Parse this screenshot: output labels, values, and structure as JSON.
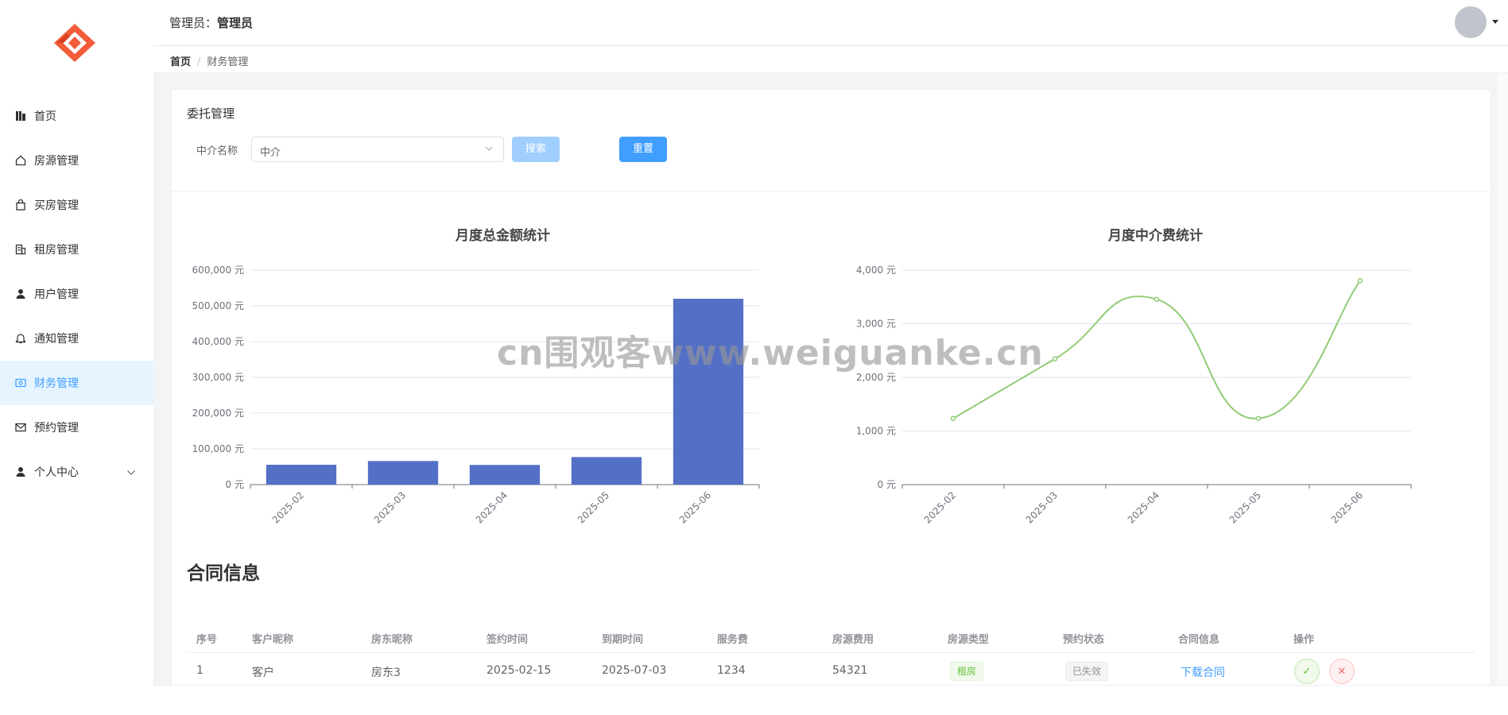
{
  "sidebar": {
    "items": [
      {
        "label": "首页",
        "icon": "dashboard-icon"
      },
      {
        "label": "房源管理",
        "icon": "home-icon"
      },
      {
        "label": "买房管理",
        "icon": "shopping-bag-icon"
      },
      {
        "label": "租房管理",
        "icon": "building-icon"
      },
      {
        "label": "用户管理",
        "icon": "user-icon"
      },
      {
        "label": "通知管理",
        "icon": "bell-icon"
      },
      {
        "label": "财务管理",
        "icon": "wallet-icon",
        "active": true
      },
      {
        "label": "预约管理",
        "icon": "mail-icon"
      },
      {
        "label": "个人中心",
        "icon": "user-icon",
        "expandable": true
      }
    ]
  },
  "header": {
    "role_label": "管理员：",
    "role_name": "管理员"
  },
  "breadcrumb": {
    "home": "首页",
    "separator": "/",
    "current": "财务管理"
  },
  "card": {
    "title": "委托管理",
    "filter": {
      "label": "中介名称",
      "value": "中介"
    },
    "search_label": "搜索",
    "reset_label": "重置"
  },
  "chart_data": [
    {
      "type": "bar",
      "title": "月度总金额统计",
      "categories": [
        "2025-02",
        "2025-03",
        "2025-04",
        "2025-05",
        "2025-06"
      ],
      "values": [
        55555,
        66000,
        55000,
        77000,
        520000
      ],
      "ylim": [
        0,
        600000
      ],
      "yticks": [
        "0 元",
        "100,000 元",
        "200,000 元",
        "300,000 元",
        "400,000 元",
        "500,000 元",
        "600,000 元"
      ],
      "color": "#5470c6",
      "grid": true
    },
    {
      "type": "line",
      "title": "月度中介费统计",
      "categories": [
        "2025-02",
        "2025-03",
        "2025-04",
        "2025-05",
        "2025-06"
      ],
      "values": [
        1234,
        2345,
        3456,
        1234,
        3800
      ],
      "ylim": [
        0,
        4000
      ],
      "yticks": [
        "0 元",
        "1,000 元",
        "2,000 元",
        "3,000 元",
        "4,000 元"
      ],
      "color": "#91cc75",
      "smooth": true,
      "grid": true
    }
  ],
  "contracts": {
    "title": "合同信息",
    "columns": [
      "序号",
      "客户昵称",
      "房东昵称",
      "签约时间",
      "到期时间",
      "服务费",
      "房源费用",
      "房源类型",
      "预约状态",
      "合同信息",
      "操作"
    ],
    "rows": [
      {
        "index": "1",
        "customer": "客户",
        "landlord": "房东3",
        "sign_date": "2025-02-15",
        "expire_date": "2025-07-03",
        "service_fee": "1234",
        "house_fee": "54321",
        "house_type": "租房",
        "status": "已失效",
        "contract_link": "下载合同",
        "approve_symbol": "✓",
        "reject_symbol": "✕"
      }
    ]
  },
  "watermark": "cn围观客www.weiguanke.cn"
}
